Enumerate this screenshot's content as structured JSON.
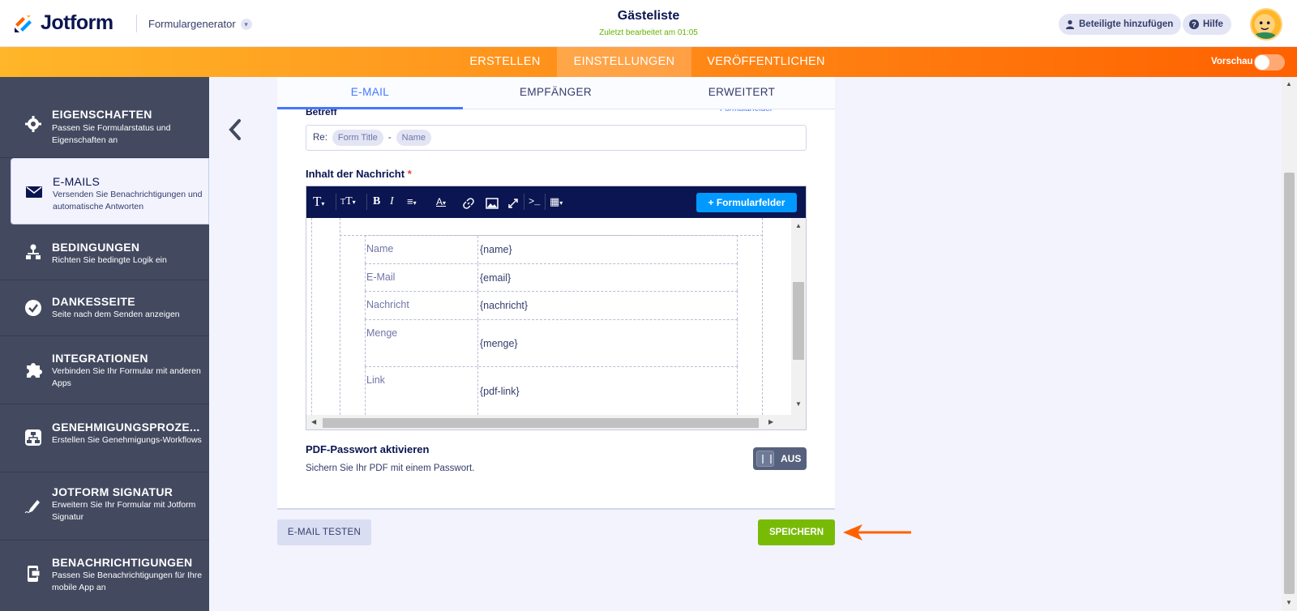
{
  "brand": {
    "logo_text": "Jotform",
    "product": "Formulargenerator"
  },
  "header": {
    "form_title": "Gästeliste",
    "last_edited": "Zuletzt bearbeitet am 01:05",
    "add_participants": "Beteiligte hinzufügen",
    "help": "Hilfe"
  },
  "topnav": {
    "tabs": [
      "ERSTELLEN",
      "EINSTELLUNGEN",
      "VERÖFFENTLICHEN"
    ],
    "active_tab": "EINSTELLUNGEN",
    "preview_label": "Vorschau",
    "preview_on": false
  },
  "sidebar": {
    "items": [
      {
        "title": "EIGENSCHAFTEN",
        "desc": "Passen Sie Formularstatus und Eigenschaften an",
        "icon": "gear-icon"
      },
      {
        "title": "E-MAILS",
        "desc": "Versenden Sie Benachrichtigungen und automatische Antworten",
        "icon": "envelope-icon"
      },
      {
        "title": "BEDINGUNGEN",
        "desc": "Richten Sie bedingte Logik ein",
        "icon": "hierarchy-icon"
      },
      {
        "title": "DANKESSEITE",
        "desc": "Seite nach dem Senden anzeigen",
        "icon": "check-circle-icon"
      },
      {
        "title": "INTEGRATIONEN",
        "desc": "Verbinden Sie Ihr Formular mit anderen Apps",
        "icon": "puzzle-icon"
      },
      {
        "title": "GENEHMIGUNGSPROZE...",
        "desc": "Erstellen Sie Genehmigungs-Workflows",
        "icon": "workflow-icon"
      },
      {
        "title": "JOTFORM SIGNATUR",
        "desc": "Erweitern Sie Ihr Formular mit Jotform Signatur",
        "icon": "pen-icon"
      },
      {
        "title": "BENACHRICHTIGUNGEN",
        "desc": "Passen Sie Benachrichtigungen für Ihre mobile App an",
        "icon": "mobile-icon"
      }
    ],
    "active_index": 1
  },
  "email_panel": {
    "subtabs": [
      "E-MAIL",
      "EMPFÄNGER",
      "ERWEITERT"
    ],
    "active_subtab": "E-MAIL",
    "subject_label": "Betreff",
    "formfields_link": "Formularfelder",
    "subject": {
      "prefix": "Re:",
      "tag1": "Form Title",
      "separator": "-",
      "tag2": "Name"
    },
    "message_label": "Inhalt der Nachricht",
    "required_mark": "*",
    "formfields_button": "+ Formularfelder",
    "table_rows": [
      {
        "label": "Name",
        "value": "{name}"
      },
      {
        "label": "E-Mail",
        "value": "{email}"
      },
      {
        "label": "Nachricht",
        "value": "{nachricht}"
      },
      {
        "label": "Menge",
        "value": "{menge}"
      },
      {
        "label": "Link",
        "value": "{pdf-link}"
      }
    ],
    "pdf_title": "PDF-Passwort aktivieren",
    "pdf_desc": "Sichern Sie Ihr PDF mit einem Passwort.",
    "pdf_toggle": "AUS"
  },
  "actions": {
    "test_email": "E-MAIL TESTEN",
    "save": "SPEICHERN"
  },
  "colors": {
    "accent": "#ff6100",
    "save": "#78bb07",
    "toolbar": "#0a1551",
    "sidebar": "#434a60",
    "link": "#4277ff"
  }
}
